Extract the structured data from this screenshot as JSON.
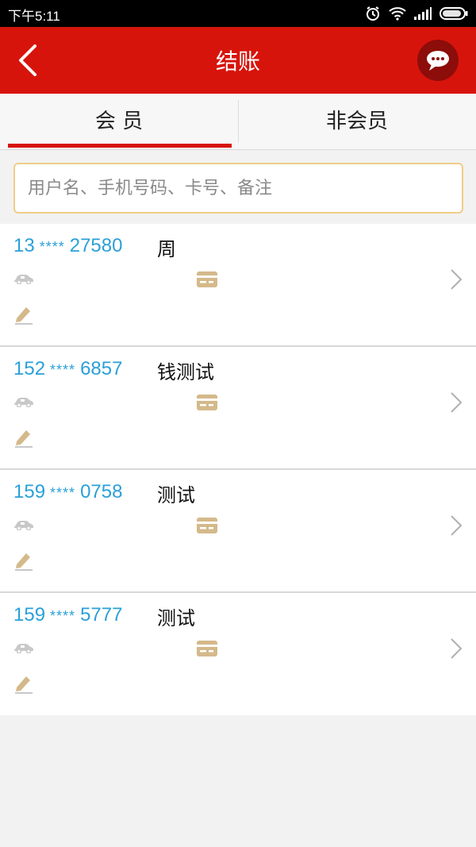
{
  "status_bar": {
    "time": "下午5:11",
    "icons": [
      "alarm-icon",
      "wifi-icon",
      "signal-icon",
      "battery-icon"
    ]
  },
  "header": {
    "title": "结账",
    "back_icon": "back-chevron-icon",
    "chat_icon": "chat-bubble-icon"
  },
  "tabs": [
    {
      "label": "会 员",
      "active": true
    },
    {
      "label": "非会员",
      "active": false
    }
  ],
  "search": {
    "placeholder": "用户名、手机号码、卡号、备注",
    "value": ""
  },
  "members": [
    {
      "prefix": "13",
      "mask": "****",
      "suffix": "27580",
      "name": "周"
    },
    {
      "prefix": "152",
      "mask": "****",
      "suffix": "6857",
      "name": "钱测试"
    },
    {
      "prefix": "159",
      "mask": "****",
      "suffix": "0758",
      "name": "测试"
    },
    {
      "prefix": "159",
      "mask": "****",
      "suffix": "5777",
      "name": "测试"
    }
  ],
  "colors": {
    "accent": "#d7140c",
    "phone": "#2aa0d8",
    "icon_gray": "#c8c8c8",
    "icon_gold": "#d4b98a",
    "search_border": "#f0cd86"
  }
}
